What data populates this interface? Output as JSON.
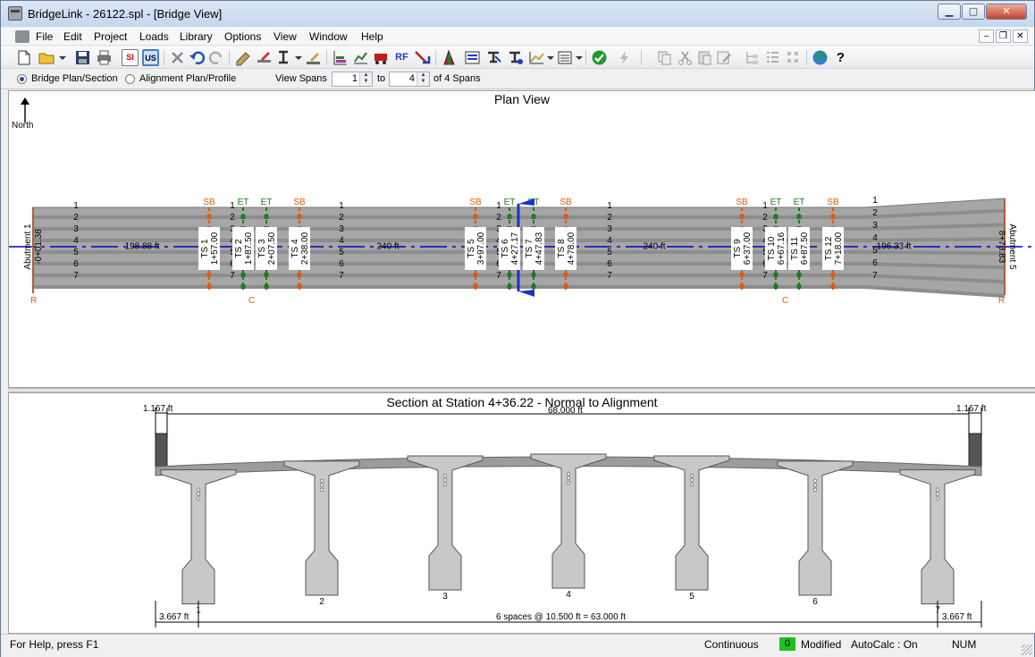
{
  "window": {
    "title": "BridgeLink - 26122.spl - [Bridge View]"
  },
  "menu": {
    "items": [
      "File",
      "Edit",
      "Project",
      "Loads",
      "Library",
      "Options",
      "View",
      "Window",
      "Help"
    ]
  },
  "toolbar": {
    "si_label": "SI",
    "us_label": "US",
    "rf_label": "RF",
    "icons": [
      "new-document-icon",
      "open-folder-icon",
      "save-icon",
      "print-icon",
      "si-units-icon",
      "us-units-icon",
      "delete-icon",
      "undo-icon",
      "redo-icon",
      "edit-bridge-icon",
      "edit-span-icon",
      "edit-girder-icon",
      "edit-pier-icon",
      "analysis-results-icon",
      "girder-graph-icon",
      "live-load-icon",
      "rating-factor-icon",
      "report-icon",
      "stability-icon",
      "girder-designer-icon",
      "camber-icon",
      "spec-check-icon",
      "report-list-icon",
      "check-icon",
      "lightning-icon",
      "copy-icon",
      "cut-icon",
      "paste-icon",
      "edit-properties-icon",
      "tree-view-icon",
      "list-view-icon",
      "grid-view-icon",
      "globe-icon",
      "help-icon"
    ]
  },
  "viewbar": {
    "option_plan": "Bridge Plan/Section",
    "option_alignment": "Alignment Plan/Profile",
    "view_spans_label": "View Spans",
    "span_from": "1",
    "to_label": "to",
    "span_to": "4",
    "of_spans_label": "of 4 Spans"
  },
  "plan": {
    "title": "Plan View",
    "north_label": "North",
    "girder_numbers": [
      "1",
      "2",
      "3",
      "4",
      "5",
      "6",
      "7"
    ],
    "abutment_1": "Abutment 1",
    "abutment_1_station": "-0+01.38",
    "abutment_5": "Abutment 5",
    "abutment_5_station": "8+73.83",
    "span_lengths": [
      "198.88 ft",
      "240 ft",
      "240 ft",
      "196.33 ft"
    ],
    "temporary_supports": [
      {
        "name": "TS 1",
        "station": "1+57.00"
      },
      {
        "name": "TS 2",
        "station": "1+87.50"
      },
      {
        "name": "TS 3",
        "station": "2+07.50"
      },
      {
        "name": "TS 4",
        "station": "2+38.00"
      },
      {
        "name": "TS 5",
        "station": "3+97.00"
      },
      {
        "name": "TS 6",
        "station": "4+27.17"
      },
      {
        "name": "TS 7",
        "station": "4+47.83"
      },
      {
        "name": "TS 8",
        "station": "4+78.00"
      },
      {
        "name": "TS 9",
        "station": "6+37.00"
      },
      {
        "name": "TS 10",
        "station": "6+67.16"
      },
      {
        "name": "TS 11",
        "station": "6+87.50"
      },
      {
        "name": "TS 12",
        "station": "7+18.00"
      }
    ],
    "marker_sb": "SB",
    "marker_et": "ET",
    "marker_r": "R",
    "marker_c": "C",
    "colors": {
      "deck": "#a9a9a9",
      "girder_band": "#8d8d8d",
      "alignment": "#0000cc",
      "sb": "#e05a10",
      "et": "#1d7a1d",
      "section_cut": "#1733c8"
    }
  },
  "section": {
    "title": "Section at Station 4+36.22 - Normal to Alignment",
    "deck_width": "68.000 ft",
    "left_barrier": "1.167 ft",
    "right_barrier": "1.167 ft",
    "girder_numbers": [
      "1",
      "2",
      "3",
      "4",
      "5",
      "6",
      "7"
    ],
    "left_overhang": "3.667 ft",
    "right_overhang": "3.667 ft",
    "spacing": "6 spaces @ 10.500 ft = 63.000 ft"
  },
  "status": {
    "help": "For Help, press F1",
    "mode": "Continuous",
    "count": "0",
    "modified": "Modified",
    "autocalc": "AutoCalc : On",
    "num": "NUM"
  }
}
